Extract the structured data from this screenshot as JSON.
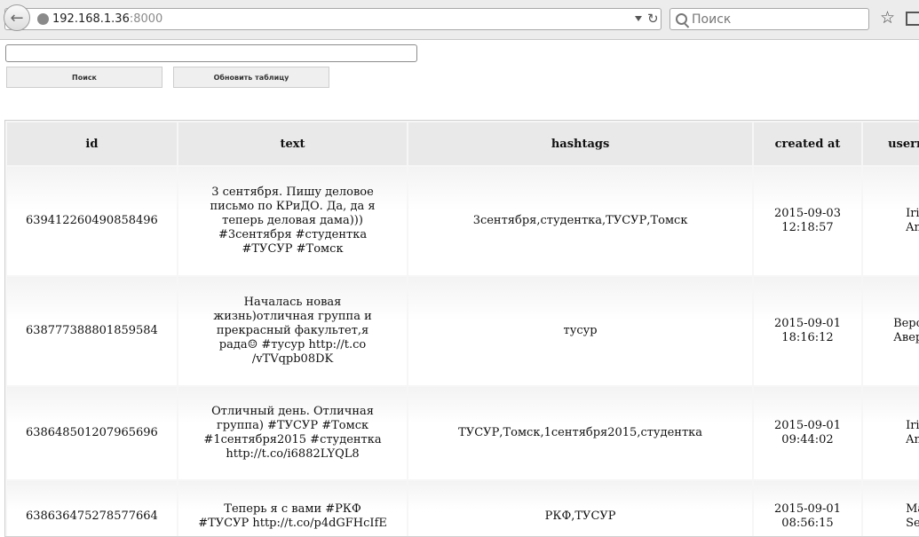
{
  "browser": {
    "url_host": "192.168.1.36",
    "url_port": ":8000",
    "search_placeholder": "Поиск"
  },
  "form": {
    "query_value": "",
    "search_button": "Поиск",
    "refresh_button": "Обновить таблицу"
  },
  "table": {
    "columns": [
      "id",
      "text",
      "hashtags",
      "created at",
      "userna"
    ],
    "rows": [
      {
        "id": "639412260490858496",
        "text": [
          "3 сентября. Пишу деловое",
          "письмо по КРиДО. Да, да я",
          "теперь деловая дама)))",
          "#3сентября #студентка",
          "#ТУСУР #Томск"
        ],
        "hashtags": "3сентября,студентка,ТУСУР,Томск",
        "created_at": [
          "2015-09-03",
          "12:18:57"
        ],
        "username": [
          "Irin",
          "Antipo"
        ]
      },
      {
        "id": "638777388801859584",
        "text": [
          "Началась новая",
          "жизнь)отличная группа и",
          "прекрасный факультет,я",
          "рада☺ #тусур http://t.co",
          "/vTVqpb08DK"
        ],
        "hashtags": "тусур",
        "created_at": [
          "2015-09-01",
          "18:16:12"
        ],
        "username": [
          "Верон",
          "Аверко"
        ]
      },
      {
        "id": "638648501207965696",
        "text": [
          "Отличный день. Отличная",
          "группа) #ТУСУР #Томск",
          "#1сентября2015 #студентка",
          "http://t.co/i6882LYQL8"
        ],
        "hashtags": "ТУСУР,Томск,1сентября2015,студентка",
        "created_at": [
          "2015-09-01",
          "09:44:02"
        ],
        "username": [
          "Irin",
          "Antipo"
        ]
      },
      {
        "id": "638636475278577664",
        "text": [
          "Теперь я с вами #РКФ",
          "#ТУСУР http://t.co/p4dGFHcIfE"
        ],
        "hashtags": "РКФ,ТУСУР",
        "created_at": [
          "2015-09-01",
          "08:56:15"
        ],
        "username": [
          "Mari",
          "Serdy"
        ]
      }
    ]
  }
}
